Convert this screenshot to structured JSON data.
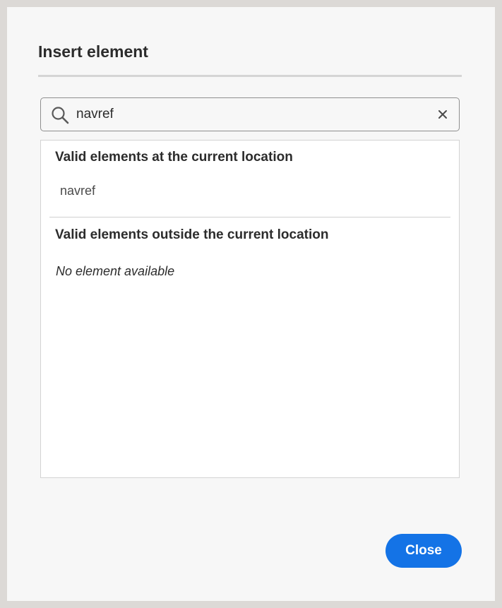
{
  "dialog": {
    "title": "Insert element"
  },
  "search": {
    "value": "navref",
    "icon": "search-icon",
    "clear_icon": "close-icon"
  },
  "results": {
    "inside": {
      "heading": "Valid elements at the current location",
      "items": [
        "navref"
      ]
    },
    "outside": {
      "heading": "Valid elements outside the current location",
      "empty_message": "No element available"
    }
  },
  "footer": {
    "close_label": "Close"
  },
  "colors": {
    "accent": "#1473e6",
    "dialog_background": "#f7f7f7",
    "backdrop": "#dcd9d6"
  }
}
